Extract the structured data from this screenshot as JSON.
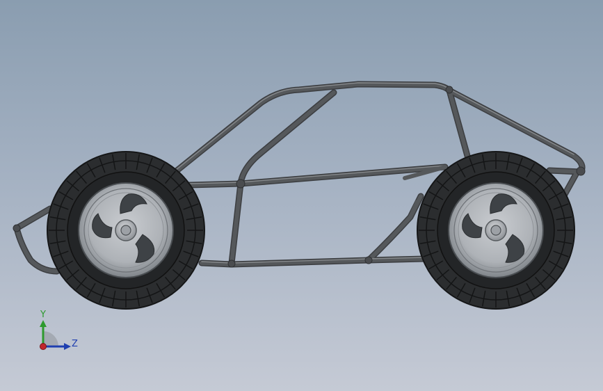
{
  "viewport": {
    "background_top": "#8a9db0",
    "background_bottom": "#c5cad5"
  },
  "model": {
    "tube_color": "#4f5154",
    "tube_highlight": "#8b8e91",
    "tire_color": "#2b2d2f",
    "rim_color": "#b7bbbf",
    "rim_dark": "#55595d"
  },
  "triad": {
    "y_label": "Y",
    "z_label": "Z",
    "y_color": "#2e9a2e",
    "z_color": "#1f3fb0",
    "x_color": "#c0282d"
  }
}
